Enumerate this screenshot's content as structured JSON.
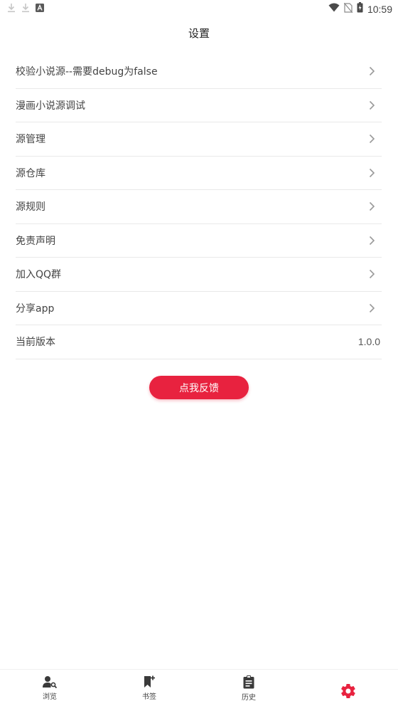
{
  "status_bar": {
    "time": "10:59",
    "left_icons": [
      "download-icon",
      "download-icon",
      "a-icon"
    ],
    "right_icons": [
      "wifi-icon",
      "no-sim-icon",
      "battery-icon"
    ]
  },
  "header": {
    "title": "设置"
  },
  "settings": {
    "items": [
      {
        "label": "校验小说源--需要debug为false",
        "chevron": true
      },
      {
        "label": "漫画小说源调试",
        "chevron": true
      },
      {
        "label": "源管理",
        "chevron": true
      },
      {
        "label": "源仓库",
        "chevron": true
      },
      {
        "label": "源规则",
        "chevron": true
      },
      {
        "label": "免责声明",
        "chevron": true
      },
      {
        "label": "加入QQ群",
        "chevron": true
      },
      {
        "label": "分享app",
        "chevron": true
      },
      {
        "label": "当前版本",
        "value": "1.0.0",
        "chevron": false
      }
    ]
  },
  "feedback_button": {
    "label": "点我反馈"
  },
  "bottom_nav": {
    "tabs": [
      {
        "label": "浏览",
        "icon": "person-search-icon"
      },
      {
        "label": "书签",
        "icon": "bookmark-add-icon"
      },
      {
        "label": "历史",
        "icon": "clipboard-icon"
      },
      {
        "label": "",
        "icon": "gear-icon",
        "active": true
      }
    ]
  },
  "colors": {
    "accent": "#e8223f",
    "text": "#444444",
    "divider": "#e9e9e9"
  }
}
